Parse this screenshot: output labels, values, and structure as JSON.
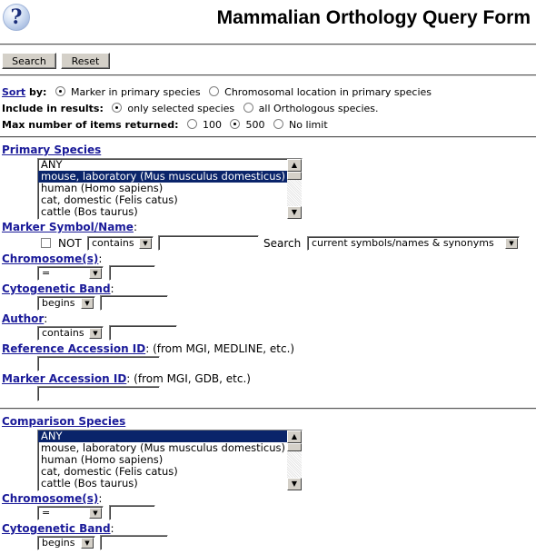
{
  "header": {
    "help_icon_glyph": "?",
    "title": "Mammalian Orthology Query Form"
  },
  "toolbar": {
    "search_label": "Search",
    "reset_label": "Reset"
  },
  "options": {
    "sort": {
      "link": "Sort",
      "label": " by:",
      "choices": [
        {
          "label": "Marker in primary species",
          "checked": true
        },
        {
          "label": "Chromosomal location in primary species",
          "checked": false
        }
      ]
    },
    "include": {
      "label": "Include in results:",
      "choices": [
        {
          "label": "only selected species",
          "checked": true
        },
        {
          "label": "all Orthologous species.",
          "checked": false
        }
      ]
    },
    "max_items": {
      "label": "Max number of items returned:",
      "choices": [
        {
          "label": "100",
          "checked": false
        },
        {
          "label": "500",
          "checked": true
        },
        {
          "label": "No limit",
          "checked": false
        }
      ]
    }
  },
  "primary": {
    "species_label": "Primary Species",
    "species_options": [
      {
        "label": "ANY",
        "selected": false
      },
      {
        "label": "mouse, laboratory (Mus musculus domesticus)",
        "selected": true
      },
      {
        "label": "human (Homo sapiens)",
        "selected": false
      },
      {
        "label": "cat, domestic (Felis catus)",
        "selected": false
      },
      {
        "label": "cattle (Bos taurus)",
        "selected": false
      }
    ],
    "marker": {
      "label": "Marker Symbol/Name",
      "not_label": "NOT",
      "operator": "contains",
      "value": "",
      "search_label": "Search",
      "search_scope": "current symbols/names & synonyms"
    },
    "chromosome": {
      "label": "Chromosome(s)",
      "operator": "=",
      "value": ""
    },
    "cyto_band": {
      "label": "Cytogenetic Band",
      "operator": "begins",
      "value": ""
    },
    "author": {
      "label": "Author",
      "operator": "contains",
      "value": ""
    },
    "reference_id": {
      "label": "Reference Accession ID",
      "note": ": (from MGI, MEDLINE, etc.)",
      "value": ""
    },
    "marker_id": {
      "label": "Marker Accession ID",
      "note": ": (from MGI, GDB, etc.)",
      "value": ""
    }
  },
  "comparison": {
    "species_label": "Comparison Species",
    "species_options": [
      {
        "label": "ANY",
        "selected": true
      },
      {
        "label": "mouse, laboratory (Mus musculus domesticus)",
        "selected": false
      },
      {
        "label": "human (Homo sapiens)",
        "selected": false
      },
      {
        "label": "cat, domestic (Felis catus)",
        "selected": false
      },
      {
        "label": "cattle (Bos taurus)",
        "selected": false
      }
    ],
    "chromosome": {
      "label": "Chromosome(s)",
      "operator": "=",
      "value": ""
    },
    "cyto_band": {
      "label": "Cytogenetic Band",
      "operator": "begins",
      "value": ""
    }
  },
  "colon": ":"
}
